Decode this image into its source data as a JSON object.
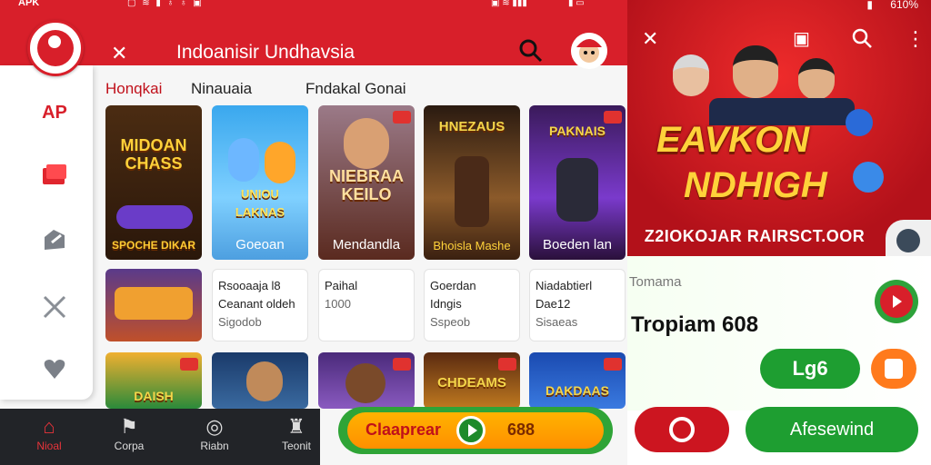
{
  "status_left": {
    "carrier": "APK",
    "battery": ""
  },
  "status_right": {
    "battery": "610%"
  },
  "header": {
    "title": "Indoanisir Undhavsia"
  },
  "sidebar": {
    "top_label": "AP"
  },
  "tabs": [
    {
      "label": "Honqkai"
    },
    {
      "label": "Ninauaia"
    },
    {
      "label": "Fndakal Gonai"
    }
  ],
  "game_cards_row1": [
    {
      "title": "MIDOAN CHASS",
      "bottom": "SPOCHE DIKAR",
      "caption": ""
    },
    {
      "title": "UNIOU LAKNAS",
      "bottom": "",
      "caption": "Goeoan"
    },
    {
      "title": "NIEBRAA KEILO",
      "bottom": "",
      "caption": "Mendandla"
    },
    {
      "title": "HNEZAUS",
      "bottom": "",
      "caption": "Bhoisla Mashe"
    },
    {
      "title": "PAKNAIS",
      "bottom": "",
      "caption": "Boeden lan"
    }
  ],
  "info_cards": [
    {
      "title": "Rsooaaja l8",
      "line2": "Ceanant oldeh",
      "line3": "Sigodob"
    },
    {
      "title": "Paihal",
      "line2": "1000",
      "line3": ""
    },
    {
      "title": "Goerdan",
      "line2": "Idngis",
      "line3": "Sspeob"
    },
    {
      "title": "Niadabtierl",
      "line2": "Dae12",
      "line3": "Sisaeas"
    }
  ],
  "game_cards_row3": [
    {
      "title": "DAISH"
    },
    {
      "title": ""
    },
    {
      "title": ""
    },
    {
      "title": "CHDEAMS"
    },
    {
      "title": "DAKDAAS"
    }
  ],
  "bottom_nav": [
    {
      "label": "Nioal",
      "active": true
    },
    {
      "label": "Corpa",
      "active": false
    },
    {
      "label": "Riabn",
      "active": false
    },
    {
      "label": "Teonit",
      "active": false
    }
  ],
  "action_button": {
    "left_label": "Claaprear",
    "right_label": "688"
  },
  "banner": {
    "title_line1": "EAVKON",
    "title_line2": "NDHIGH",
    "subtitle": "Z2IOKOJAR RAIRSCT.OOR"
  },
  "promo": {
    "label": "Tomama",
    "value": "Tropiam 608",
    "log_button": "Lg6",
    "bottom_button": "Afesewind"
  },
  "colors": {
    "brand_red": "#d81f2a",
    "green": "#1e9e31",
    "orange": "#ff8f00"
  }
}
